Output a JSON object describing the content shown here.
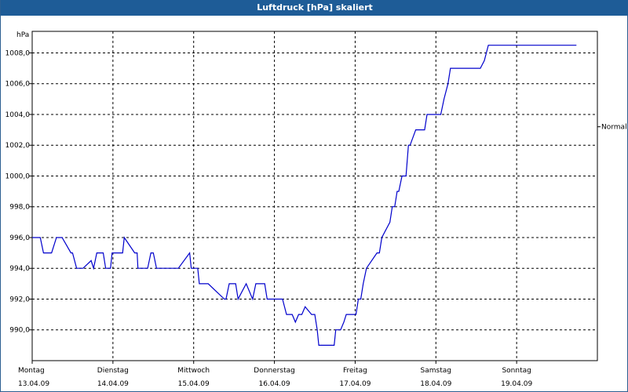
{
  "window": {
    "title": "Luftdruck [hPa] skaliert"
  },
  "chart_data": {
    "type": "line",
    "title": "Luftdruck [hPa] skaliert",
    "ylabel": "hPa",
    "ylim": [
      988,
      1009.4
    ],
    "yticks": [
      990,
      992,
      994,
      996,
      998,
      1000,
      1002,
      1004,
      1006,
      1008
    ],
    "ytick_labels": [
      "990,0",
      "992,0",
      "994,0",
      "996,0",
      "998,0",
      "1000,0",
      "1002,0",
      "1004,0",
      "1006,0",
      "1008,0"
    ],
    "x_range": [
      0,
      7
    ],
    "x_ticks": [
      {
        "x": 0,
        "weekday": "Montag",
        "date": "13.04.09"
      },
      {
        "x": 1,
        "weekday": "Dienstag",
        "date": "14.04.09"
      },
      {
        "x": 2,
        "weekday": "Mittwoch",
        "date": "15.04.09"
      },
      {
        "x": 3,
        "weekday": "Donnerstag",
        "date": "16.04.09"
      },
      {
        "x": 4,
        "weekday": "Freitag",
        "date": "17.04.09"
      },
      {
        "x": 5,
        "weekday": "Samstag",
        "date": "18.04.09"
      },
      {
        "x": 6,
        "weekday": "Sonntag",
        "date": "19.04.09"
      }
    ],
    "grid": true,
    "reference_line": {
      "label": "Normal",
      "value": 1003.2
    },
    "line_color": "#0000cc",
    "series": [
      {
        "x": [
          0,
          0.1,
          0.14,
          0.24,
          0.3,
          0.33,
          0.37,
          0.48,
          0.5,
          0.55,
          0.6,
          0.63,
          0.73,
          0.76,
          0.8,
          0.83,
          0.88,
          0.91,
          0.94,
          0.97,
          0.99,
          1.12,
          1.14,
          1.27,
          1.3,
          1.31,
          1.4,
          1.43,
          1.47,
          1.5,
          1.54,
          1.62,
          1.81,
          1.95,
          1.97,
          2.05,
          2.07,
          2.18,
          2.38,
          2.4,
          2.44,
          2.47,
          2.52,
          2.55,
          2.6,
          2.65,
          2.73,
          2.77,
          2.88,
          2.91,
          3.1,
          3.15,
          3.18,
          3.22,
          3.26,
          3.3,
          3.34,
          3.38,
          3.46,
          3.5,
          3.53,
          3.55,
          3.64,
          3.74,
          3.76,
          3.79,
          3.82,
          3.86,
          3.89,
          4.01,
          4.04,
          4.07,
          4.1,
          4.14,
          4.27,
          4.3,
          4.33,
          4.43,
          4.46,
          4.49,
          4.52,
          4.54,
          4.58,
          4.63,
          4.66,
          4.68,
          4.75,
          4.78,
          4.86,
          4.89,
          5.06,
          5.1,
          5.15,
          5.18,
          5.2,
          5.25,
          5.3,
          5.35,
          5.4,
          5.45,
          5.55,
          5.6,
          5.65,
          5.72,
          5.75,
          5.82,
          5.87,
          5.93,
          5.96,
          6.03,
          6.08,
          6.13,
          6.18,
          6.2,
          6.25,
          6.3,
          6.36,
          6.43,
          6.6,
          6.67,
          6.71,
          6.74
        ],
        "y": [
          996,
          996,
          995,
          995,
          996,
          996,
          996,
          995,
          995,
          994,
          994,
          994,
          994.5,
          994,
          995,
          995,
          995,
          994,
          994,
          994,
          995,
          995,
          996,
          995,
          995,
          994,
          994,
          994,
          995,
          995,
          994,
          994,
          994,
          995,
          994,
          994,
          993,
          993,
          992,
          992,
          993,
          993,
          993,
          992,
          992.5,
          993,
          992,
          993,
          993,
          992,
          992,
          991,
          991,
          991,
          990.5,
          991,
          991,
          991.5,
          991,
          991,
          990,
          989,
          989,
          989,
          990,
          990,
          990,
          990.5,
          991,
          991,
          992,
          992,
          993,
          994,
          995,
          995,
          996,
          997,
          998,
          998,
          999,
          999,
          1000,
          1000,
          1002,
          1002,
          1003,
          1003,
          1003,
          1004,
          1004,
          1005,
          1006,
          1007,
          1007,
          1007,
          1007,
          1007,
          1007,
          1007,
          1007,
          1007.5,
          1008.5,
          1008.5,
          1008.5,
          1008.5,
          1008.5,
          1008.5,
          1008.5,
          1008.5,
          1008.5,
          1008.5,
          1008.5,
          1008.5,
          1008.5,
          1008.5,
          1008.5,
          1008.5,
          1008.5,
          1008.5,
          1008.5,
          1008.5
        ]
      }
    ]
  }
}
